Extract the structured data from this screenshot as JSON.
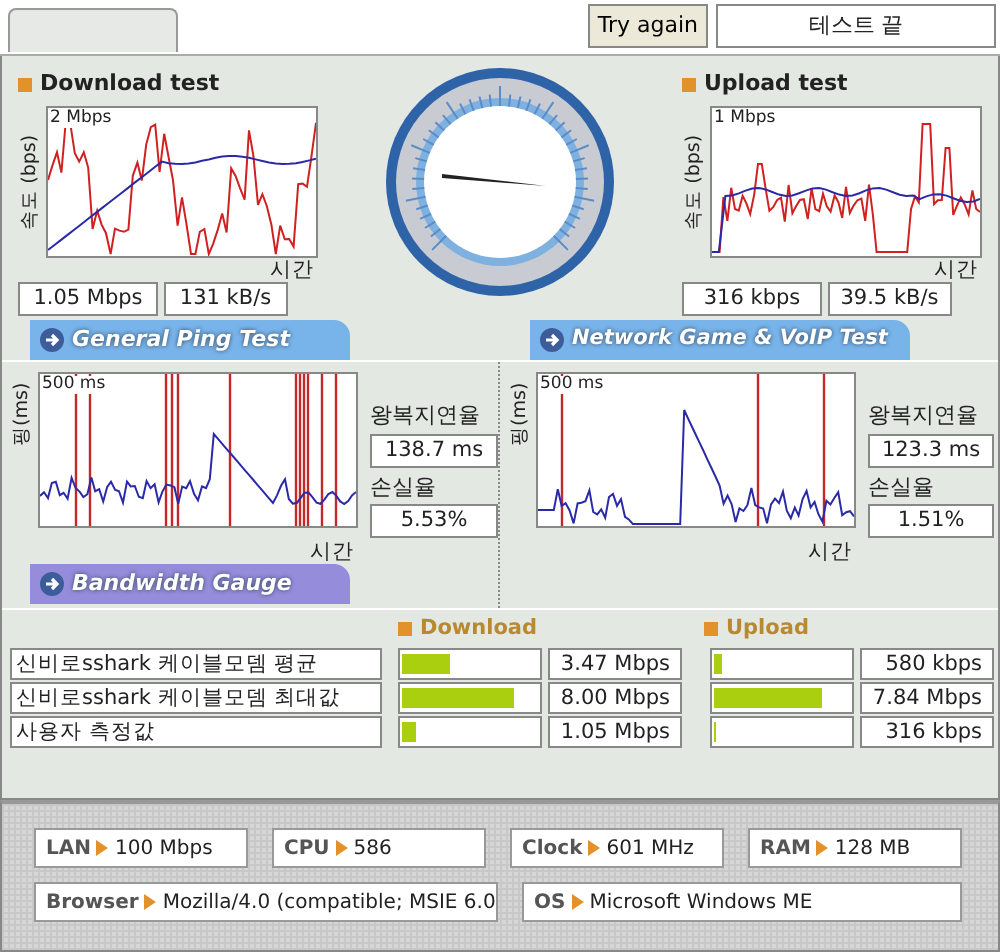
{
  "header": {
    "try_again": "Try again",
    "status": "테스트 끝"
  },
  "speed_tests": [
    {
      "title": "Download test",
      "y_axis": "속도 (bps)",
      "scale": "2 Mbps",
      "x_axis": "시간",
      "rate": "1.05 Mbps",
      "bytes": "131 kB/s"
    },
    {
      "title": "Upload test",
      "y_axis": "속도 (bps)",
      "scale": "1 Mbps",
      "x_axis": "시간",
      "rate": "316 kbps",
      "bytes": "39.5 kB/s"
    }
  ],
  "ping_heading": "General Ping Test",
  "game_heading": "Network Game & VoIP Test",
  "ping_tests": [
    {
      "y_axis": "핑(ms)",
      "scale": "500 ms",
      "x_axis": "시간",
      "latency_label": "왕복지연율",
      "latency": "138.7 ms",
      "loss_label": "손실율",
      "loss": "5.53%"
    },
    {
      "y_axis": "핑(ms)",
      "scale": "500 ms",
      "x_axis": "시간",
      "latency_label": "왕복지연율",
      "latency": "123.3 ms",
      "loss_label": "손실율",
      "loss": "1.51%"
    }
  ],
  "bandwidth": {
    "heading": "Bandwidth Gauge",
    "columns": [
      "Download",
      "Upload"
    ],
    "rows": [
      {
        "label": "신비로sshark 케이블모뎀 평균",
        "download": {
          "level": 0.35,
          "value": "3.47 Mbps"
        },
        "upload": {
          "level": 0.06,
          "value": "580 kbps"
        }
      },
      {
        "label": "신비로sshark 케이블모뎀 최대값",
        "download": {
          "level": 0.83,
          "value": "8.00 Mbps"
        },
        "upload": {
          "level": 0.8,
          "value": "7.84 Mbps"
        }
      },
      {
        "label": "사용자 측정값",
        "download": {
          "level": 0.1,
          "value": "1.05 Mbps"
        },
        "upload": {
          "level": 0.02,
          "value": "316 kbps"
        }
      }
    ]
  },
  "system_info": [
    [
      {
        "label": "LAN",
        "value": "100 Mbps"
      },
      {
        "label": "CPU",
        "value": "586"
      },
      {
        "label": "Clock",
        "value": "601 MHz"
      },
      {
        "label": "RAM",
        "value": "128 MB"
      }
    ],
    [
      {
        "label": "Browser",
        "value": "Mozilla/4.0 (compatible; MSIE 6.0"
      },
      {
        "label": "OS",
        "value": "Microsoft Windows ME"
      }
    ]
  ]
}
